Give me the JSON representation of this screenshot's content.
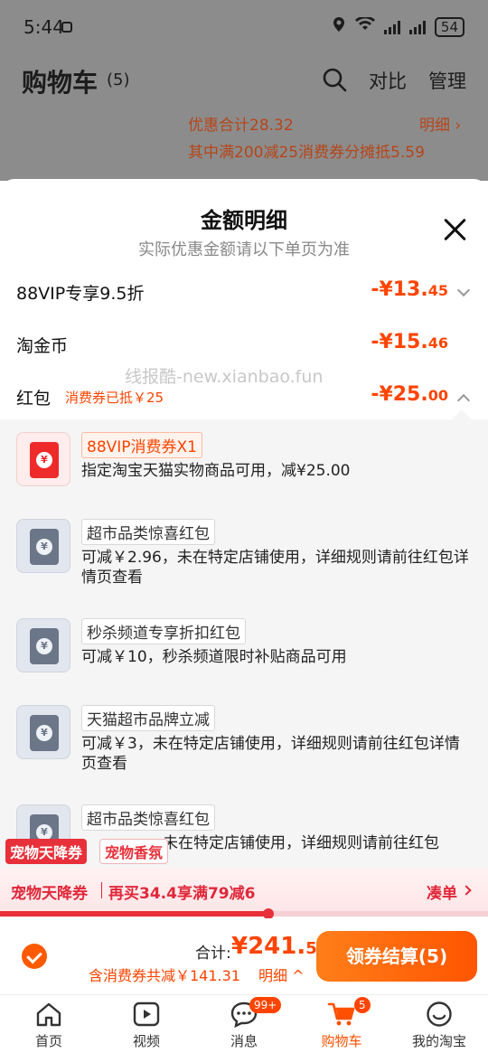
{
  "status_bar": {
    "time": "5:44",
    "battery": "54",
    "signal_label": "6"
  },
  "header": {
    "title": "购物车",
    "count": "(5)",
    "compare": "对比",
    "manage": "管理"
  },
  "discount_bar": {
    "total": "优惠合计28.32",
    "detail": "明细 ›",
    "sub": "其中满200减25消费券分摊抵5.59"
  },
  "sheet": {
    "title": "金额明细",
    "subtitle": "实际优惠金额请以下单页为准",
    "rows": [
      {
        "label": "88VIP专享9.5折",
        "amount_main": "-¥13.",
        "amount_dec": "45"
      },
      {
        "label": "淘金币",
        "amount_main": "-¥15.",
        "amount_dec": "46"
      },
      {
        "label": "红包",
        "tag": "消费券已抵￥25",
        "amount_main": "-¥25.",
        "amount_dec": "00"
      }
    ],
    "watermark": "线报酷-new.xianbao.fun"
  },
  "coupons": [
    {
      "name": "88VIP消费券X1",
      "desc": "指定淘宝天猫实物商品可用，减¥25.00"
    },
    {
      "name": "超市品类惊喜红包",
      "desc": "可减￥2.96，未在特定店铺使用，详细规则请前往红包详情页查看"
    },
    {
      "name": "秒杀频道专享折扣红包",
      "desc": "可减￥10，秒杀频道限时补贴商品可用"
    },
    {
      "name": "天猫超市品牌立减",
      "desc": "可减￥3，未在特定店铺使用，详细规则请前往红包详情页查看"
    },
    {
      "name": "超市品类惊喜红包",
      "desc": "未在特定店铺使用，详细规则请前往红包"
    }
  ],
  "coupon_icon_symbol": "¥",
  "pet": {
    "tag1": "宠物天降券",
    "tag2": "宠物香氛"
  },
  "promo": {
    "label": "宠物天降券",
    "text": "再买34.4享满79减6",
    "action": "凑单",
    "progress_fraction": 0.55
  },
  "checkout": {
    "total_label": "合计:",
    "total_main": "¥241.",
    "total_dec": "59",
    "savings": "含消费券共减￥141.31",
    "detail": "明细 ^",
    "button": "领券结算(5)"
  },
  "tabbar": [
    {
      "label": "首页",
      "icon": "home-icon"
    },
    {
      "label": "视频",
      "icon": "video-icon"
    },
    {
      "label": "消息",
      "icon": "message-icon",
      "badge": "99+"
    },
    {
      "label": "购物车",
      "icon": "cart-icon",
      "badge": "5",
      "active": true
    },
    {
      "label": "我的淘宝",
      "icon": "profile-icon"
    }
  ],
  "colors": {
    "accent": "#ff4400",
    "promo_red": "#e0283a",
    "checkout_orange": "#ff5a00"
  }
}
